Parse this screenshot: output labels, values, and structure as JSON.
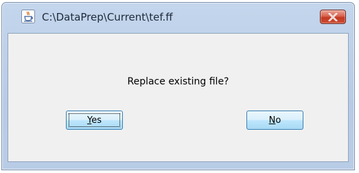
{
  "window": {
    "title": "C:\\DataPrep\\Current\\tef.ff",
    "icon": "java-cup-icon",
    "close_icon": "close-x-icon"
  },
  "dialog": {
    "message": "Replace existing file?",
    "buttons": {
      "yes": {
        "mnemonic": "Y",
        "rest": "es",
        "focused": true
      },
      "no": {
        "mnemonic": "N",
        "rest": "o",
        "focused": false
      }
    }
  },
  "colors": {
    "close_button": "#c23a22",
    "button_accent": "#3c7fb1",
    "client_bg": "#f0f0f0",
    "frame": "#b9cce6"
  }
}
